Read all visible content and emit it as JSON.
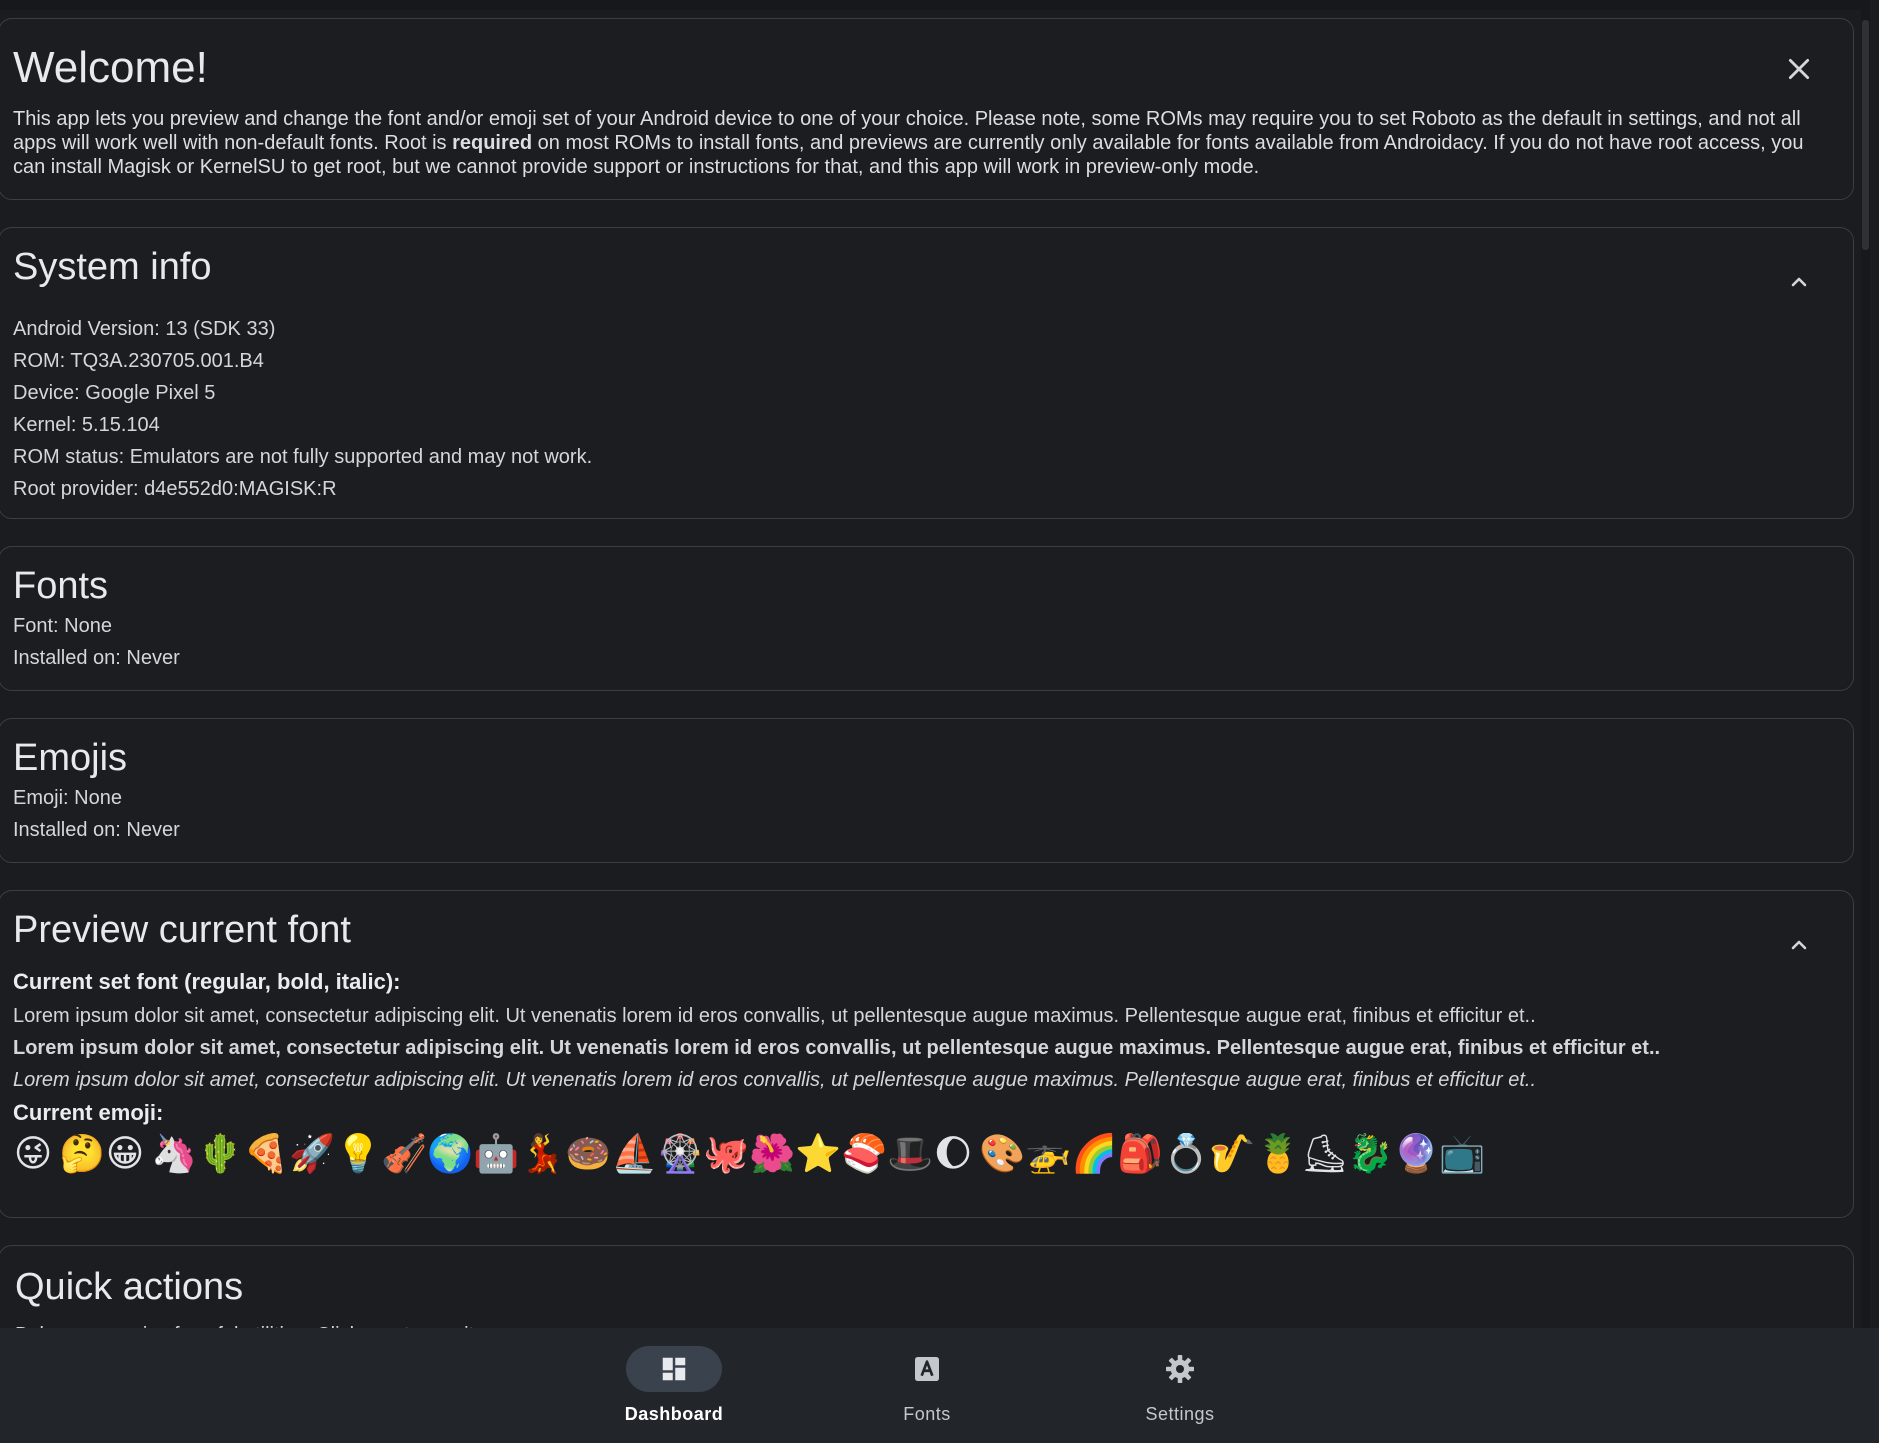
{
  "welcome": {
    "title": "Welcome!",
    "text_1": "This app lets you preview and change the font and/or emoji set of your Android device to one of your choice. Please note, some ROMs may require you to set Roboto as the default in settings, and not all apps will work well with non-default fonts. Root is ",
    "text_bold": "required",
    "text_2": " on most ROMs to install fonts, and previews are currently only available for fonts available from Androidacy. If you do not have root access, you can install Magisk or KernelSU to get root, but we cannot provide support or instructions for that, and this app will work in preview-only mode.",
    "close_icon": "close-icon"
  },
  "system_info": {
    "title": "System info",
    "lines": [
      "Android Version: 13 (SDK 33)",
      "ROM: TQ3A.230705.001.B4",
      "Device: Google Pixel 5",
      "Kernel: 5.15.104",
      "ROM status: Emulators are not fully supported and may not work.",
      "Root provider: d4e552d0:MAGISK:R"
    ]
  },
  "fonts_card": {
    "title": "Fonts",
    "font_line": "Font: None",
    "installed_line": "Installed on: Never"
  },
  "emojis_card": {
    "title": "Emojis",
    "emoji_line": "Emoji: None",
    "installed_line": "Installed on: Never"
  },
  "preview": {
    "title": "Preview current font",
    "font_heading": "Current set font (regular, bold, italic):",
    "sample": "Lorem ipsum dolor sit amet, consectetur adipiscing elit. Ut venenatis lorem id eros convallis, ut pellentesque augue maximus. Pellentesque augue erat, finibus et efficitur et..",
    "emoji_heading": "Current emoji:",
    "emojis": [
      "😜",
      "🤔",
      "😀",
      "🦄",
      "🌵",
      "🍕",
      "🚀",
      "💡",
      "🎻",
      "🌍",
      "🤖",
      "💃",
      "🍩",
      "⛵",
      "🎡",
      "🐙",
      "🌺",
      "⭐",
      "🍣",
      "🎩",
      "🌔",
      "🎨",
      "🚁",
      "🌈",
      "🎒",
      "💍",
      "🎷",
      "🍍",
      "⛸",
      "🐉",
      "🔮",
      "📺"
    ]
  },
  "quick_actions": {
    "title": "Quick actions",
    "subtitle": "Below are a mix of useful utilities. Click one to use it."
  },
  "nav": {
    "items": [
      {
        "label": "Dashboard",
        "icon": "dashboard-icon"
      },
      {
        "label": "Fonts",
        "icon": "font-icon"
      },
      {
        "label": "Settings",
        "icon": "gear-icon"
      }
    ],
    "active": "Dashboard"
  }
}
